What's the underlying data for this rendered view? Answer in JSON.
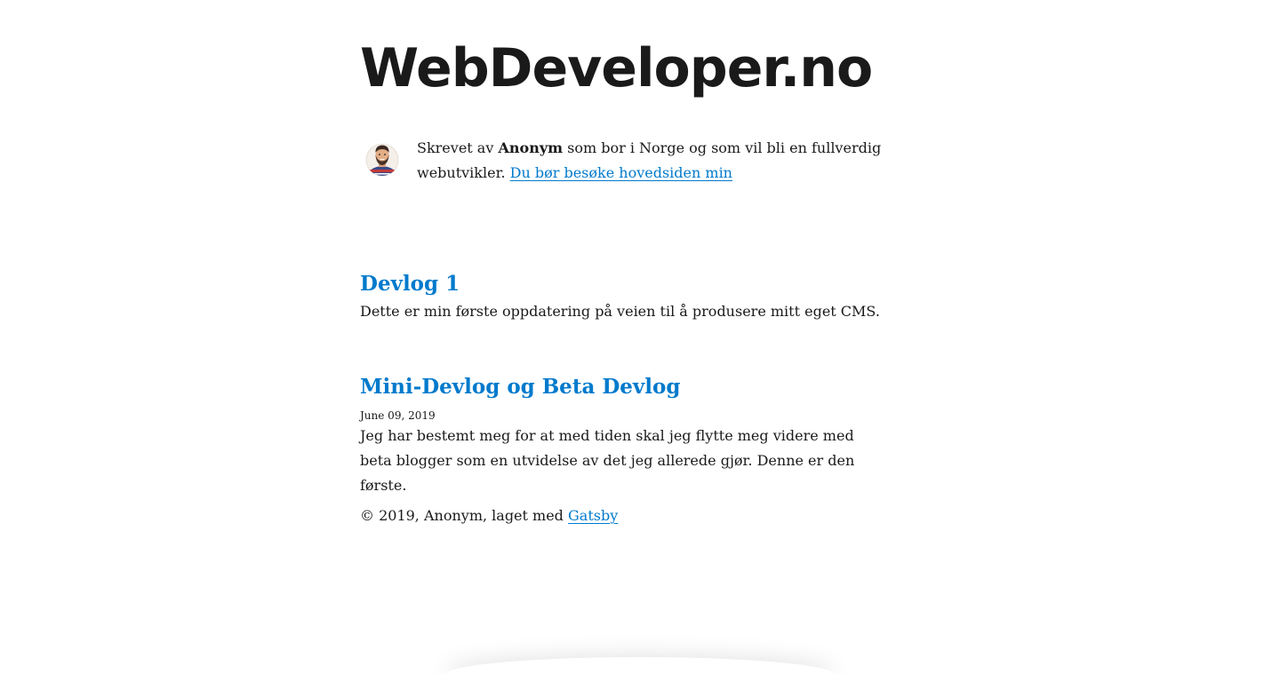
{
  "site": {
    "title": "WebDeveloper.no"
  },
  "bio": {
    "prefix": "Skrevet av ",
    "author": "Anonym",
    "suffix": " som bor i Norge og som vil bli en fullverdig webutvikler. ",
    "link_label": "Du bør besøke hovedsiden min",
    "avatar_icon": "avatar-icon"
  },
  "posts": [
    {
      "title": "Devlog 1",
      "date": "",
      "excerpt": "Dette er min første oppdatering på veien til å produsere mitt eget CMS."
    },
    {
      "title": "Mini-Devlog og Beta Devlog",
      "date": "June 09, 2019",
      "excerpt": "Jeg har bestemt meg for at med tiden skal jeg flytte meg videre med beta blogger som en utvidelse av det jeg allerede gjør. Denne er den første."
    }
  ],
  "footer": {
    "text": "© 2019, Anonym, laget med ",
    "link_label": "Gatsby"
  },
  "colors": {
    "link": "#007acc",
    "text": "#1a1a1a",
    "background": "#ffffff"
  }
}
